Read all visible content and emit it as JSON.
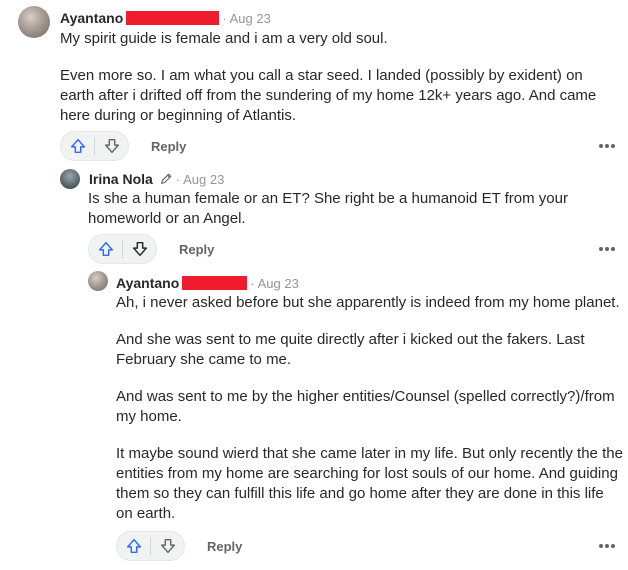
{
  "comments": [
    {
      "author": "Ayantano",
      "date": "Aug 23",
      "paragraphs": [
        "My spirit guide is female and i am a very old soul.",
        "Even more so. I am what you call a star seed. I landed (possibly by exident) on earth after i drifted off from the sundering of my home 12k+ years ago. And came here during or beginning of Atlantis."
      ],
      "reply_label": "Reply"
    },
    {
      "author": "Irina Nola",
      "date": "Aug 23",
      "paragraphs": [
        "Is she a human female or an ET? She right be a humanoid ET from your homeworld or an Angel."
      ],
      "reply_label": "Reply"
    },
    {
      "author": "Ayantano",
      "date": "Aug 23",
      "paragraphs": [
        "Ah, i never asked before but she apparently is indeed from my home planet.",
        "And she was sent to me quite directly after i kicked out the fakers. Last February she came to me.",
        "And was sent to me by the higher entities/Counsel (spelled correctly?)/from my home.",
        "It maybe sound wierd that she came later in my life. But only recently the the entities from my home are searching for lost souls of our home. And guiding them so they can fulfill this life and go home after they are done in this life on earth."
      ],
      "reply_label": "Reply"
    }
  ],
  "separator": "·",
  "colors": {
    "redaction": "#ee1c2e",
    "upvote": "#2e69ff",
    "text": "#282829",
    "muted": "#939598",
    "action": "#636466"
  },
  "icons": {
    "upvote": "arrow-up-outline-icon",
    "downvote": "arrow-down-outline-icon",
    "edit": "pencil-icon",
    "more": "ellipsis-icon"
  }
}
